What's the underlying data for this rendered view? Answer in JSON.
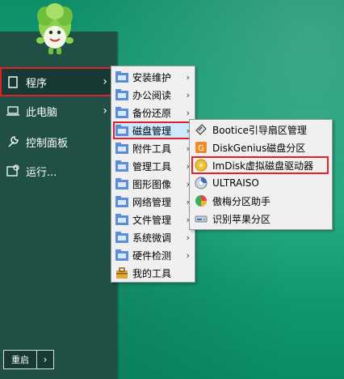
{
  "start_menu": {
    "items": [
      {
        "label": "程序",
        "icon": "document-icon"
      },
      {
        "label": "此电脑",
        "icon": "laptop-icon"
      },
      {
        "label": "控制面板",
        "icon": "wrench-icon"
      },
      {
        "label": "运行...",
        "icon": "run-icon"
      }
    ],
    "restart_label": "重启",
    "restart_arrow": "›"
  },
  "programs_submenu": {
    "items": [
      {
        "label": "安装维护"
      },
      {
        "label": "办公阅读"
      },
      {
        "label": "备份还原"
      },
      {
        "label": "磁盘管理"
      },
      {
        "label": "附件工具"
      },
      {
        "label": "管理工具"
      },
      {
        "label": "图形图像"
      },
      {
        "label": "网络管理"
      },
      {
        "label": "文件管理"
      },
      {
        "label": "系统微调"
      },
      {
        "label": "硬件检测"
      },
      {
        "label": "我的工具"
      }
    ]
  },
  "disk_submenu": {
    "items": [
      {
        "label": "Bootice引导扇区管理",
        "icon": "bootice-icon"
      },
      {
        "label": "DiskGenius磁盘分区",
        "icon": "diskgenius-icon"
      },
      {
        "label": "ImDisk虚拟磁盘驱动器",
        "icon": "imdisk-icon"
      },
      {
        "label": "ULTRAISO",
        "icon": "ultraiso-icon"
      },
      {
        "label": "傲梅分区助手",
        "icon": "partition-assistant-icon"
      },
      {
        "label": "识别苹果分区",
        "icon": "apple-partition-icon"
      }
    ]
  },
  "colors": {
    "highlight": "#e0202a",
    "panel": "#1f4f45",
    "selected": "#cde8ff"
  }
}
